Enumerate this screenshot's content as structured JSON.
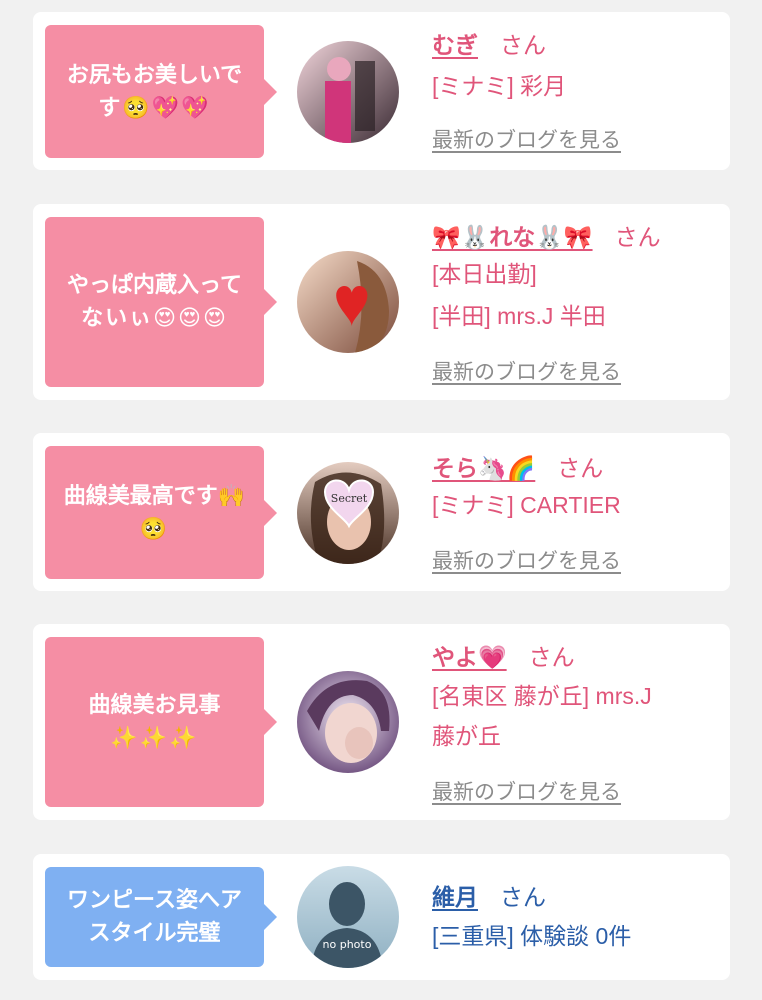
{
  "reviews": [
    {
      "bubble_lines": [
        "お尻もお美しいで",
        "す🥺💖💖"
      ],
      "name": "むぎ",
      "honorific": "さん",
      "lines": [
        "[ミナミ] 彩月"
      ],
      "blog_link": "最新のブログを見る",
      "avatar": "photo-woman-pink-kimono"
    },
    {
      "bubble_lines": [
        "やっぱ内蔵入って",
        "ないぃ😍😍😍"
      ],
      "name": "🎀🐰れな🐰🎀",
      "honorific": "さん",
      "lines": [
        "[本日出勤]",
        "[半田] mrs.J 半田"
      ],
      "blog_link": "最新のブログを見る",
      "avatar": "photo-woman-heart-sticker"
    },
    {
      "bubble_lines": [
        "曲線美最高です🙌",
        "🥺"
      ],
      "name": "そら🦄🌈",
      "honorific": "さん",
      "lines": [
        "[ミナミ] CARTIER"
      ],
      "blog_link": "最新のブログを見る",
      "avatar": "photo-woman-secret-heart",
      "avatar_text": "Secret"
    },
    {
      "bubble_lines": [
        "曲線美お見事",
        "✨✨✨"
      ],
      "name": "やよ💗",
      "honorific": "さん",
      "lines": [
        "[名東区 藤が丘] mrs.J",
        "藤が丘"
      ],
      "blog_link": "最新のブログを見る",
      "avatar": "photo-woman-hand-face"
    },
    {
      "bubble_lines": [
        "ワンピース姿へア",
        "スタイル完璧"
      ],
      "name": "維月",
      "honorific": "さん",
      "lines": [
        "[三重県] 体験談 0件"
      ],
      "avatar": "no-photo-silhouette",
      "avatar_text": "no photo"
    }
  ],
  "colors": {
    "pink_bubble": "#f58ea4",
    "blue_bubble": "#7fb0f2",
    "pink_text": "#e0557a",
    "blue_text": "#2b5ea8",
    "link_gray": "#8c8c8c",
    "background": "#f1f1f1"
  }
}
